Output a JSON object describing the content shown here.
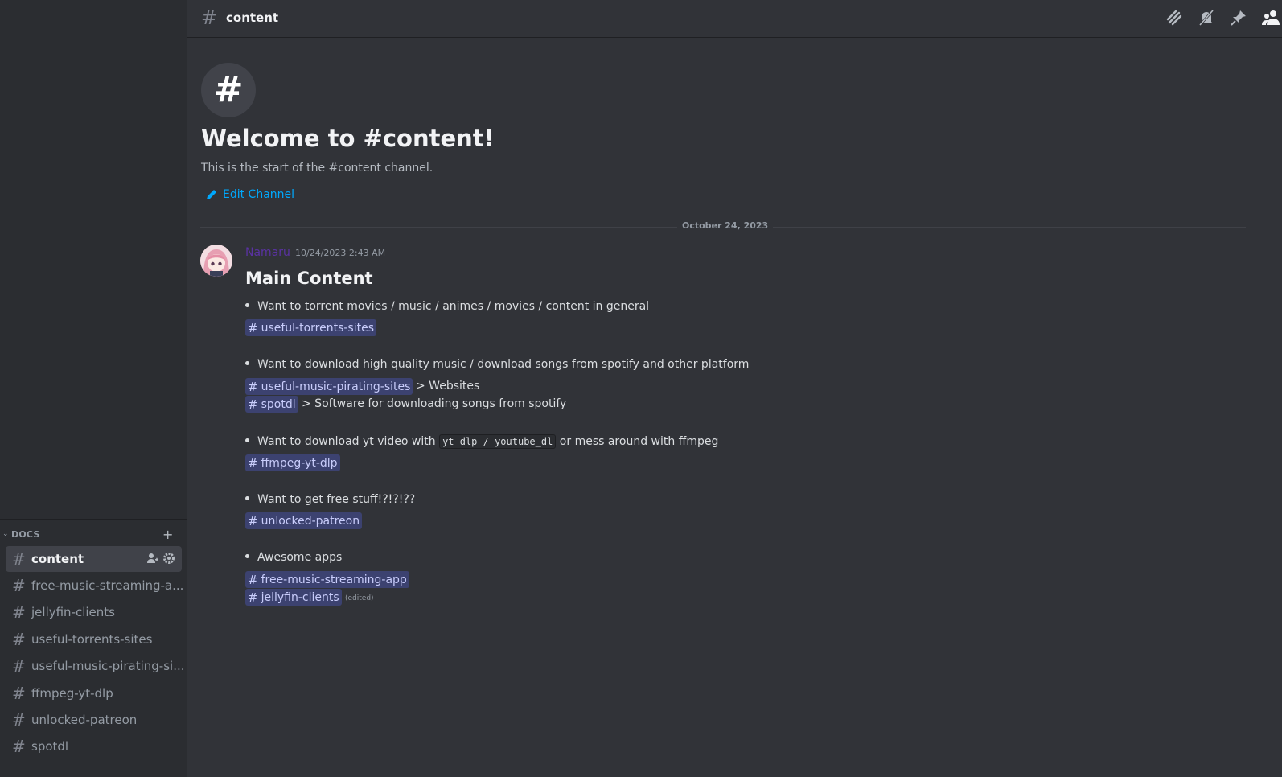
{
  "header": {
    "channel_name": "content"
  },
  "sidebar": {
    "category": "DOCS",
    "channels": [
      {
        "name": "content",
        "active": true
      },
      {
        "name": "free-music-streaming-a..."
      },
      {
        "name": "jellyfin-clients"
      },
      {
        "name": "useful-torrents-sites"
      },
      {
        "name": "useful-music-pirating-si..."
      },
      {
        "name": "ffmpeg-yt-dlp"
      },
      {
        "name": "unlocked-patreon"
      },
      {
        "name": "spotdl"
      }
    ]
  },
  "welcome": {
    "title": "Welcome to #content!",
    "subtitle": "This is the start of the #content channel.",
    "edit_label": "Edit Channel"
  },
  "date_divider": "October 24, 2023",
  "message": {
    "author": "Namaru",
    "timestamp": "10/24/2023 2:43 AM",
    "heading": "Main Content",
    "bullet_1": "Want to torrent movies / music / animes / movies / content in general",
    "mention_1": "useful-torrents-sites",
    "bullet_2": "Want to download high quality music / download songs from spotify and other platform",
    "mention_2": "useful-music-pirating-sites",
    "after_2": "> Websites",
    "mention_3": "spotdl",
    "after_3": "> Software for downloading songs from spotify",
    "bullet_3_pre": "Want to download yt video with",
    "bullet_3_code": "yt-dlp / youtube_dl",
    "bullet_3_post": "or mess around with ffmpeg",
    "mention_4": "ffmpeg-yt-dlp",
    "bullet_4": "Want to get free stuff!?!?!??",
    "mention_5": "unlocked-patreon",
    "bullet_5": "Awesome apps",
    "mention_6": "free-music-streaming-app",
    "mention_7": "jellyfin-clients",
    "edited": "(edited)"
  }
}
